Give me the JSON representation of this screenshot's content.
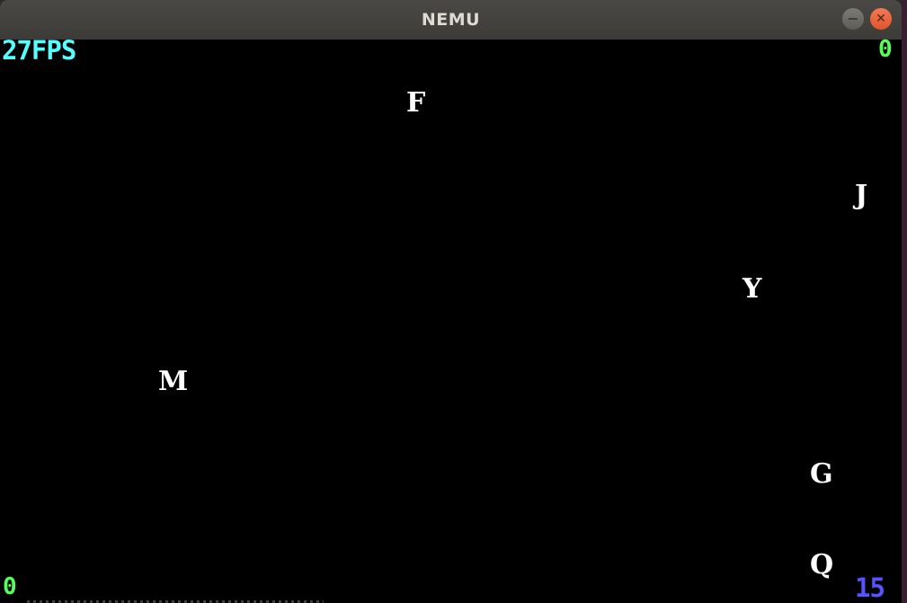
{
  "window": {
    "title": "NEMU",
    "controls": {
      "minimize_icon": "minimize-icon",
      "close_icon": "close-icon",
      "minimize_glyph": "−",
      "close_glyph": "✕"
    }
  },
  "hud": {
    "fps": "27FPS",
    "hit_count": "0",
    "miss_count": "0",
    "level": "15",
    "colors": {
      "fps": "#55ffff",
      "hit_count": "#55ff55",
      "miss_count": "#55ff55",
      "level": "#5555ff"
    }
  },
  "falling_letters": [
    "F",
    "J",
    "Y",
    "M",
    "G",
    "Q"
  ],
  "colors": {
    "background": "#000000",
    "letter": "#ffffff",
    "titlebar": "#3c3b37",
    "close_button": "#e4532a"
  }
}
